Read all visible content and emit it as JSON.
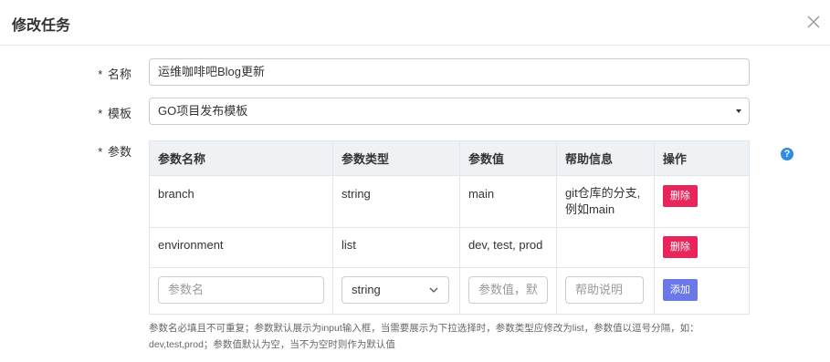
{
  "dialog": {
    "title": "修改任务"
  },
  "form": {
    "name_label": "名称",
    "name_value": "运维咖啡吧Blog更新",
    "template_label": "模板",
    "template_value": "GO项目发布模板",
    "params_label": "参数",
    "required_mark": "*"
  },
  "table": {
    "headers": [
      "参数名称",
      "参数类型",
      "参数值",
      "帮助信息",
      "操作"
    ],
    "rows": [
      {
        "name": "branch",
        "type": "string",
        "value": "main",
        "help_line1": "git仓库的分支,",
        "help_line2": "例如main",
        "action": "删除"
      },
      {
        "name": "environment",
        "type": "list",
        "value": "dev, test, prod",
        "help_line1": "",
        "help_line2": "",
        "action": "删除"
      }
    ],
    "new_row": {
      "name_placeholder": "参数名",
      "type_value": "string",
      "value_placeholder": "参数值，默",
      "help_placeholder": "帮助说明",
      "action": "添加"
    }
  },
  "hint": {
    "line1": "参数名必填且不可重复；参数默认展示为input输入框，当需要展示为下拉选择时，参数类型应修改为list，参数值以逗号分隔，如：",
    "line2": "dev,test,prod；参数值默认为空，当不为空时则作为默认值"
  },
  "colors": {
    "delete": "#e8245b",
    "add": "#6b79e8",
    "help_icon": "#2e8ce0"
  },
  "icons": {
    "close": "close-icon",
    "help": "question-circle-icon",
    "caret": "caret-down-icon",
    "chevron": "chevron-down-icon"
  }
}
